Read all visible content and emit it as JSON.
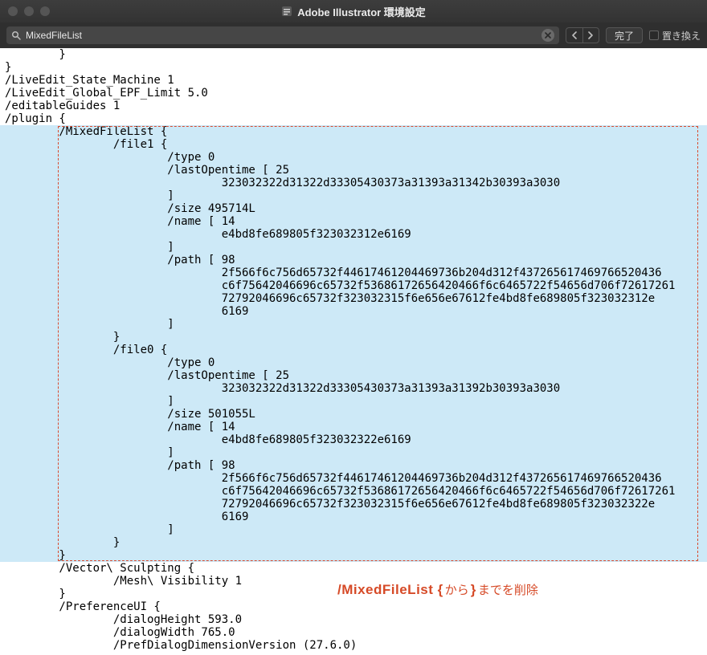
{
  "window": {
    "title": "Adobe Illustrator 環境設定"
  },
  "toolbar": {
    "search_value": "MixedFileList",
    "done_label": "完了",
    "replace_label": "置き換え"
  },
  "code": {
    "pre_lines": [
      "        }",
      "}",
      "/LiveEdit_State_Machine 1",
      "/LiveEdit_Global_EPF_Limit 5.0",
      "/editableGuides 1",
      "/plugin {"
    ],
    "mixed_block": [
      "        /MixedFileList {",
      "                /file1 {",
      "                        /type 0",
      "                        /lastOpentime [ 25",
      "                                323032322d31322d33305430373a31393a31342b30393a3030",
      "                        ]",
      "                        /size 495714L",
      "                        /name [ 14",
      "                                e4bd8fe689805f323032312e6169",
      "                        ]",
      "                        /path [ 98",
      "                                2f566f6c756d65732f44617461204469736b204d312f437265617469766520436",
      "                                c6f75642046696c65732f53686172656420466f6c6465722f54656d706f72617261",
      "                                72792046696c65732f323032315f6e656e67612fe4bd8fe689805f323032312e",
      "                                6169",
      "                        ]",
      "                }",
      "                /file0 {",
      "                        /type 0",
      "                        /lastOpentime [ 25",
      "                                323032322d31322d33305430373a31393a31392b30393a3030",
      "                        ]",
      "                        /size 501055L",
      "                        /name [ 14",
      "                                e4bd8fe689805f323032322e6169",
      "                        ]",
      "                        /path [ 98",
      "                                2f566f6c756d65732f44617461204469736b204d312f437265617469766520436",
      "                                c6f75642046696c65732f53686172656420466f6c6465722f54656d706f72617261",
      "                                72792046696c65732f323032315f6e656e67612fe4bd8fe689805f323032322e",
      "                                6169",
      "                        ]",
      "                }",
      "        }"
    ],
    "post_lines": [
      "        /Vector\\ Sculpting {",
      "                /Mesh\\ Visibility 1",
      "        }",
      "        /PreferenceUI {",
      "                /dialogHeight 593.0",
      "                /dialogWidth 765.0",
      "                /PrefDialogDimensionVersion (27.6.0)"
    ]
  },
  "annotation": {
    "part1": "/MixedFileList {",
    "part2": " から ",
    "part3": "}",
    "part4": " までを削除"
  },
  "icons": {
    "app": "app-prefs-icon",
    "search": "search-icon",
    "clear": "clear-icon",
    "left": "chevron-left-icon",
    "right": "chevron-right-icon"
  }
}
